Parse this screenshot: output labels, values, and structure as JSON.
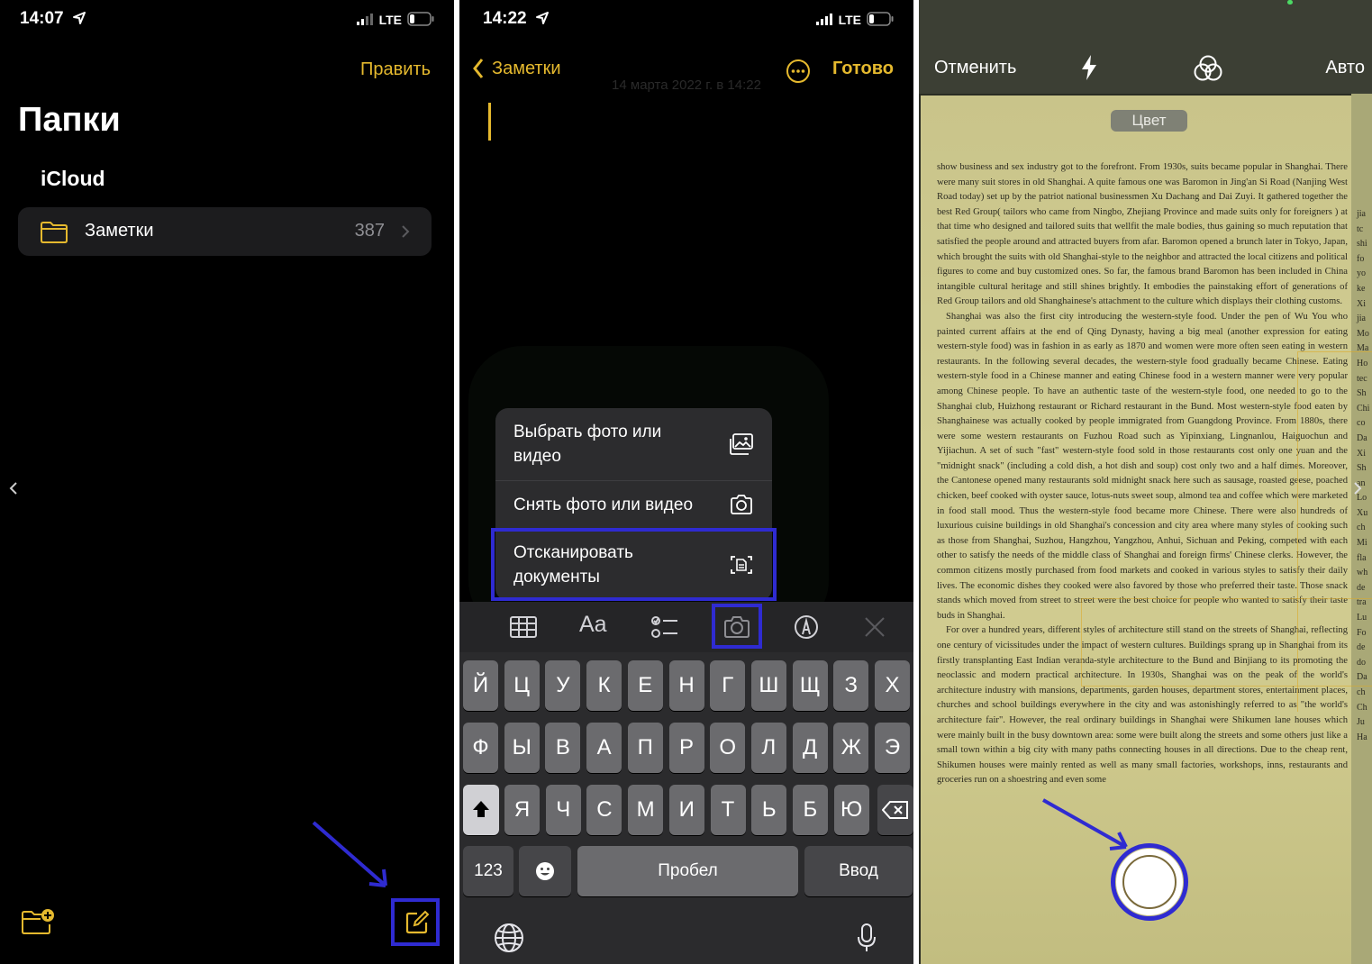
{
  "panel1": {
    "status": {
      "time": "14:07",
      "network": "LTE"
    },
    "edit_label": "Править",
    "title": "Папки",
    "section": "iCloud",
    "folder": {
      "name": "Заметки",
      "count": "387"
    }
  },
  "panel2": {
    "status": {
      "time": "14:22",
      "network": "LTE"
    },
    "back_label": "Заметки",
    "done_label": "Готово",
    "date": "14 марта 2022 г. в 14:22",
    "menu": [
      {
        "label": "Выбрать фото или видео",
        "icon": "photo-library-icon"
      },
      {
        "label": "Снять фото или видео",
        "icon": "camera-icon"
      },
      {
        "label": "Отсканировать документы",
        "icon": "scan-document-icon"
      }
    ],
    "toolbar": {
      "format_label": "Aa"
    },
    "keyboard": {
      "row1": [
        "Й",
        "Ц",
        "У",
        "К",
        "Е",
        "Н",
        "Г",
        "Ш",
        "Щ",
        "З",
        "Х"
      ],
      "row2": [
        "Ф",
        "Ы",
        "В",
        "А",
        "П",
        "Р",
        "О",
        "Л",
        "Д",
        "Ж",
        "Э"
      ],
      "row3": [
        "Я",
        "Ч",
        "С",
        "М",
        "И",
        "Т",
        "Ь",
        "Б",
        "Ю"
      ],
      "numbers_label": "123",
      "space_label": "Пробел",
      "return_label": "Ввод"
    }
  },
  "panel3": {
    "cancel_label": "Отменить",
    "auto_label": "Авто",
    "mode_label": "Цвет",
    "paragraphs": [
      "show business and sex industry got to the forefront. From 1930s, suits became popular in Shanghai. There were many suit stores in old Shanghai. A quite famous one was Baromon in Jing'an Si Road (Nanjing West Road today) set up by the patriot national businessmen Xu Dachang and Dai Zuyi. It gathered together the best Red Group( tailors who came from Ningbo, Zhejiang Province and made suits only for foreigners ) at that time who designed and tailored suits that wellfit the male bodies, thus gaining so much reputation that satisfied the people around and attracted buyers from afar. Baromon opened a brunch later in Tokyo, Japan, which brought the suits with old Shanghai-style to the neighbor and attracted the local citizens and political figures to come and buy customized ones. So far, the famous brand Baromon has been included in China intangible cultural heritage and still shines brightly. It embodies the painstaking effort of generations of Red Group tailors and old Shanghainese's attachment to the culture which displays their clothing customs.",
      "Shanghai was also the first city introducing the western-style food. Under the pen of Wu You who painted current affairs at the end of Qing Dynasty, having a big meal (another expression for eating western-style food) was in fashion in as early as 1870 and women were more often seen eating in western restaurants. In the following several decades, the western-style food gradually became Chinese. Eating western-style food in a Chinese manner and eating Chinese food in a western manner were very popular among Chinese people. To have an authentic taste of the western-style food, one needed to go to the Shanghai club, Huizhong restaurant or Richard restaurant in the Bund. Most western-style food eaten by Shanghainese was actually cooked by people immigrated from Guangdong Province. From 1880s, there were some western restaurants on Fuzhou Road such as Yipinxiang, Lingnanlou, Haiguochun and Yijiachun. A set of such \"fast\" western-style food sold in those restaurants cost only one yuan and the \"midnight snack\" (including a cold dish, a hot dish and soup) cost only two and a half dimes. Moreover, the Cantonese opened many restaurants sold midnight snack here such as sausage, roasted geese, poached chicken, beef cooked with oyster sauce, lotus-nuts sweet soup, almond tea and coffee which were marketed in food stall mood. Thus the western-style food became more Chinese. There were also hundreds of luxurious cuisine buildings in old Shanghai's concession and city area where many styles of cooking such as those from Shanghai, Suzhou, Hangzhou, Yangzhou, Anhui, Sichuan and Peking, competed with each other to satisfy the needs of the middle class of Shanghai and foreign firms' Chinese clerks. However, the common citizens mostly purchased from food markets and cooked in various styles to satisfy their daily lives. The economic dishes they cooked were also favored by those who preferred their taste. Those snack stands which moved from street to street were the best choice for people who wanted to satisfy their taste buds in Shanghai.",
      "For over a hundred years, different styles of architecture still stand on the streets of Shanghai, reflecting one century of vicissitudes under the impact of western cultures. Buildings sprang up in Shanghai from its firstly transplanting East Indian veranda-style architecture to the Bund and Binjiang to its promoting the neoclassic and modern practical architecture. In 1930s, Shanghai was on the peak of the world's architecture industry with mansions, departments, garden houses, department stores, entertainment places, churches and school buildings everywhere in the city and was astonishingly referred to as \"the world's architecture fair\". However, the real ordinary buildings in Shanghai were Shikumen lane houses which were mainly built in the busy downtown area: some were built along the streets and some others just like a small town within a big city with many paths connecting houses in all directions. Due to the cheap rent, Shikumen houses were mainly rented as well as many small factories, workshops, inns, restaurants and groceries run on a shoestring and even some"
    ],
    "edge_letters": [
      "jia",
      "tc",
      "shi",
      "fo",
      "yo",
      "ke",
      "Xi",
      "jia",
      "Mo",
      "Ma",
      "Ho",
      "tec",
      "Sh",
      "Chi",
      "co",
      "Da",
      "Xi",
      "Sh",
      "an",
      "Lo",
      "Xu",
      "ch",
      "Mi",
      "fla",
      "wh",
      "de",
      "tra",
      "Lu",
      "Fo",
      "de",
      "do",
      "Da",
      "ch",
      "Ch",
      "Ju",
      "Ha"
    ]
  }
}
